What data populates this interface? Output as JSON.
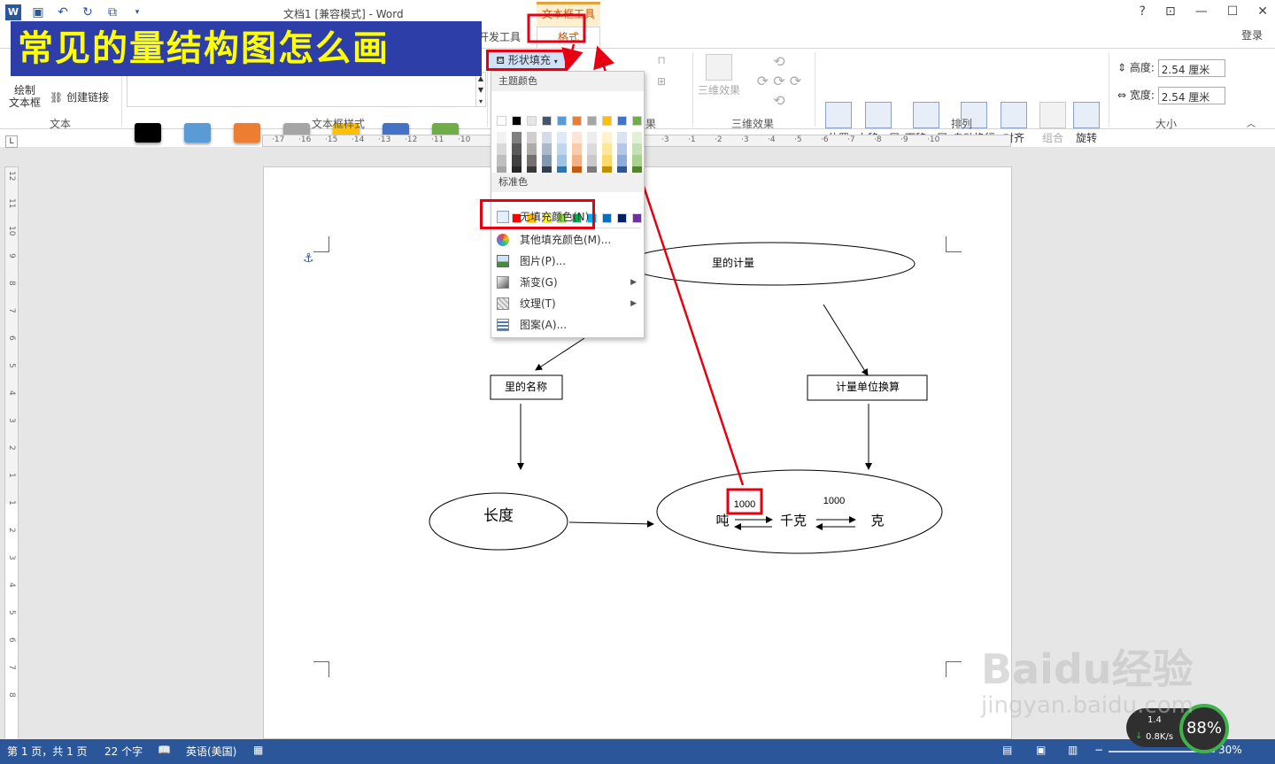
{
  "window": {
    "title": "文档1 [兼容模式] - Word",
    "context_tab": "文本框工具",
    "help": "?",
    "login": "登录"
  },
  "headline": "常见的量结构图怎么画",
  "tabs": {
    "developer": "开发工具",
    "format": "格式"
  },
  "ribbon": {
    "text_group": {
      "draw_textbox": "绘制\n文本框",
      "create_link": "创建链接",
      "label": "文本"
    },
    "style_group": {
      "label": "文本框样式",
      "shape_fill": "形状填充",
      "swatches": [
        "#000000",
        "#5b9bd5",
        "#ed7d31",
        "#a5a5a5",
        "#ffc000",
        "#4472c4",
        "#70ad47"
      ]
    },
    "shadow_group": {
      "label": "果"
    },
    "threed_group": {
      "button": "三维效果",
      "label": "三维效果"
    },
    "arrange_group": {
      "label": "排列",
      "buttons": [
        "位置",
        "上移一层",
        "下移一层",
        "自动换行",
        "对齐",
        "组合",
        "旋转"
      ]
    },
    "size_group": {
      "label": "大小",
      "height_label": "高度:",
      "height_value": "2.54 厘米",
      "width_label": "宽度:",
      "width_value": "2.54 厘米"
    }
  },
  "ruler": {
    "horizontal": [
      "17",
      "16",
      "15",
      "14",
      "13",
      "12",
      "11",
      "10",
      "3",
      "1",
      "2",
      "3",
      "4",
      "5",
      "6",
      "7",
      "8",
      "9",
      "10"
    ],
    "vertical": [
      "12",
      "11",
      "10",
      "9",
      "8",
      "7",
      "6",
      "5",
      "4",
      "3",
      "2",
      "1",
      "1",
      "2",
      "3",
      "4",
      "5",
      "6",
      "7",
      "8"
    ]
  },
  "dropdown": {
    "theme_colors_header": "主题颜色",
    "standard_colors_header": "标准色",
    "theme_top_row": [
      "#ffffff",
      "#000000",
      "#e7e6e6",
      "#44546a",
      "#5b9bd5",
      "#ed7d31",
      "#a5a5a5",
      "#ffc000",
      "#4472c4",
      "#70ad47"
    ],
    "theme_columns": [
      [
        "#f2f2f2",
        "#d9d9d9",
        "#bfbfbf",
        "#a6a6a6",
        "#808080"
      ],
      [
        "#7f7f7f",
        "#595959",
        "#404040",
        "#262626",
        "#0d0d0d"
      ],
      [
        "#d0cece",
        "#aeabab",
        "#757171",
        "#3a3838",
        "#171616"
      ],
      [
        "#d6dce5",
        "#adb9ca",
        "#8497b0",
        "#333f50",
        "#222a35"
      ],
      [
        "#deebf7",
        "#bdd7ee",
        "#9dc3e6",
        "#2e75b6",
        "#1f4e79"
      ],
      [
        "#fbe5d6",
        "#f8cbad",
        "#f4b183",
        "#c55a11",
        "#843c0c"
      ],
      [
        "#ededed",
        "#dbdbdb",
        "#c9c9c9",
        "#7b7b7b",
        "#525252"
      ],
      [
        "#fff2cc",
        "#ffe699",
        "#ffd966",
        "#bf9000",
        "#7f6000"
      ],
      [
        "#dae3f3",
        "#b4c7e7",
        "#8faadc",
        "#2f5597",
        "#203864"
      ],
      [
        "#e2f0d9",
        "#c5e0b4",
        "#a9d18e",
        "#548235",
        "#385723"
      ]
    ],
    "standard_colors": [
      "#c00000",
      "#ff0000",
      "#ffc000",
      "#ffff00",
      "#92d050",
      "#00b050",
      "#00b0f0",
      "#0070c0",
      "#002060",
      "#7030a0"
    ],
    "items": [
      {
        "label": "无填充颜色(N)",
        "icon": "no-fill-icon"
      },
      {
        "label": "其他填充颜色(M)...",
        "icon": "color-wheel-icon"
      },
      {
        "label": "图片(P)...",
        "icon": "picture-icon"
      },
      {
        "label": "渐变(G)",
        "icon": "gradient-icon",
        "submenu": true
      },
      {
        "label": "纹理(T)",
        "icon": "texture-icon",
        "submenu": true
      },
      {
        "label": "图案(A)...",
        "icon": "pattern-icon"
      }
    ]
  },
  "diagram": {
    "root": "里的计量",
    "left_box": "里的名称",
    "right_box": "计量单位换算",
    "length": "长度",
    "ton": "吨",
    "kilogram": "千克",
    "gram": "克",
    "factor1": "1000",
    "factor2": "1000"
  },
  "statusbar": {
    "page": "第 1 页，共 1 页",
    "words": "22 个字",
    "language": "英语(美国)",
    "zoom": "30%"
  },
  "netbadge": {
    "up": "1.4",
    "down": "0.8K/s",
    "percent": "88%"
  },
  "watermark": {
    "brand": "Baidu经验",
    "url": "jingyan.baidu.com"
  },
  "colors": {
    "headline_bg": "#2e3ea8",
    "headline_text": "#ffff00",
    "annotation_red": "#e60012",
    "status_bg": "#2b579a"
  }
}
